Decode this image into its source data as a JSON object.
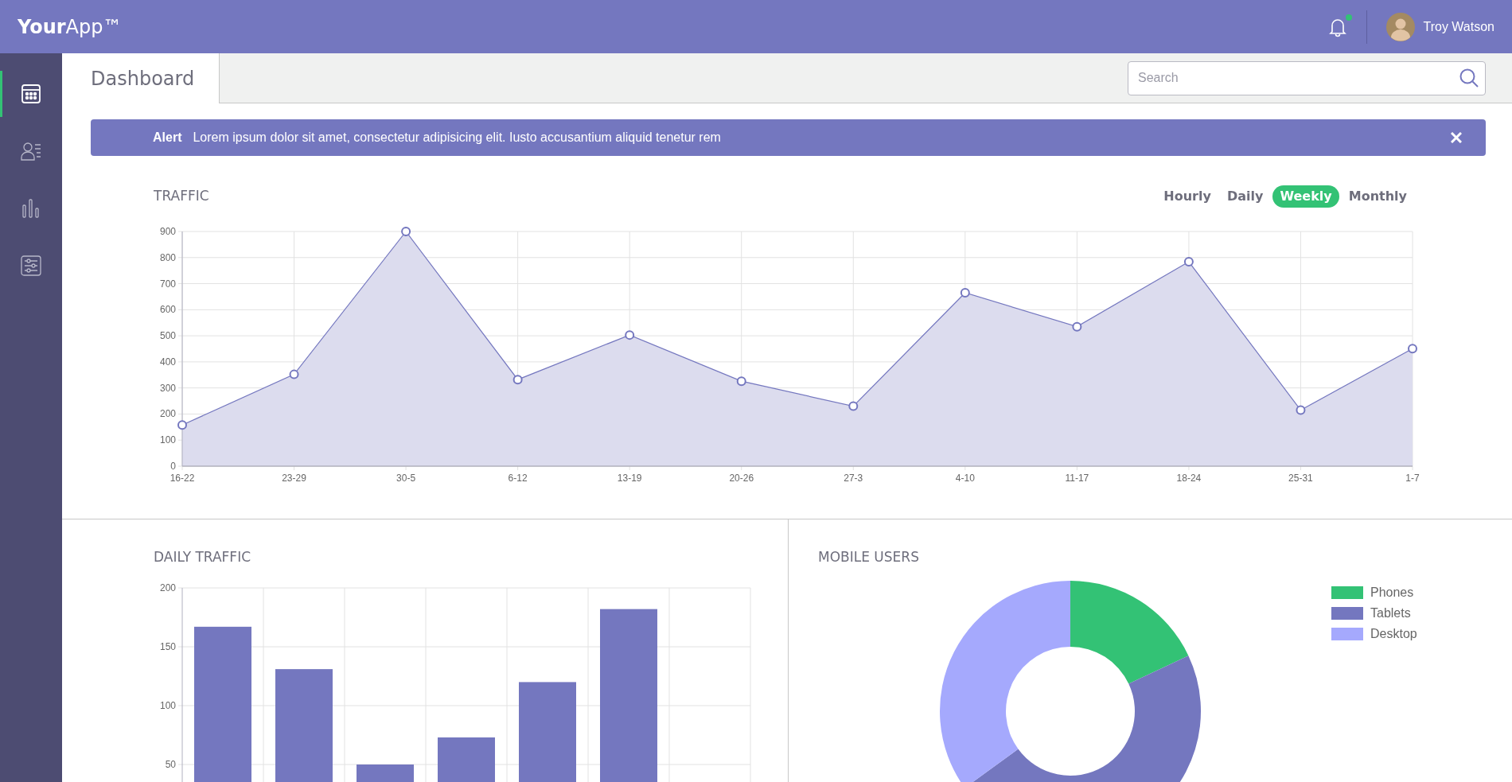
{
  "header": {
    "logo": "**Your**App™",
    "notifications": {
      "unread": true
    },
    "user": {
      "name": "Troy Watson"
    }
  },
  "sidebar": {
    "items": [
      {
        "kind": "calendar",
        "selected": true
      },
      {
        "kind": "contacts",
        "selected": false
      },
      {
        "kind": "chart",
        "selected": false
      },
      {
        "kind": "sliders",
        "selected": false
      }
    ]
  },
  "page_title": "Dashboard",
  "search": {
    "placeholder": "Search"
  },
  "alert": {
    "label": "Alert",
    "message": "Lorem ipsum dolor sit amet, consectetur adipisicing elit. Iusto accusantium aliquid tenetur rem"
  },
  "traffic": {
    "title": "TRAFFIC",
    "periods": [
      {
        "label": "Hourly",
        "selected": false
      },
      {
        "label": "Daily",
        "selected": false
      },
      {
        "label": "Weekly",
        "selected": true
      },
      {
        "label": "Monthly",
        "selected": false
      }
    ],
    "chart_data": {
      "type": "area",
      "categories": [
        "16-22",
        "23-29",
        "30-5",
        "6-12",
        "13-19",
        "20-26",
        "27-3",
        "4-10",
        "11-17",
        "18-24",
        "25-31",
        "1-7"
      ],
      "values": [
        158,
        352,
        900,
        332,
        503,
        326,
        230,
        665,
        535,
        784,
        215,
        451
      ],
      "ylim": [
        0,
        900
      ],
      "yticks": [
        0,
        100,
        200,
        300,
        400,
        500,
        600,
        700,
        800,
        900
      ],
      "grid": true
    }
  },
  "daily_traffic": {
    "title": "DAILY TRAFFIC",
    "chart_data": {
      "type": "bar",
      "values": [
        167,
        131,
        50,
        73,
        120,
        182,
        null
      ],
      "ylim": [
        0,
        200
      ],
      "yticks": [
        50,
        100,
        150,
        200
      ],
      "grid": true
    }
  },
  "mobile_users": {
    "title": "MOBILE USERS",
    "chart_data": {
      "type": "donut",
      "categories": [
        "Phones",
        "Tablets",
        "Desktop"
      ],
      "values": [
        18,
        47,
        35
      ],
      "colors": [
        "#33c275",
        "#7477bf",
        "#a5a9fd"
      ],
      "legend": true
    }
  }
}
